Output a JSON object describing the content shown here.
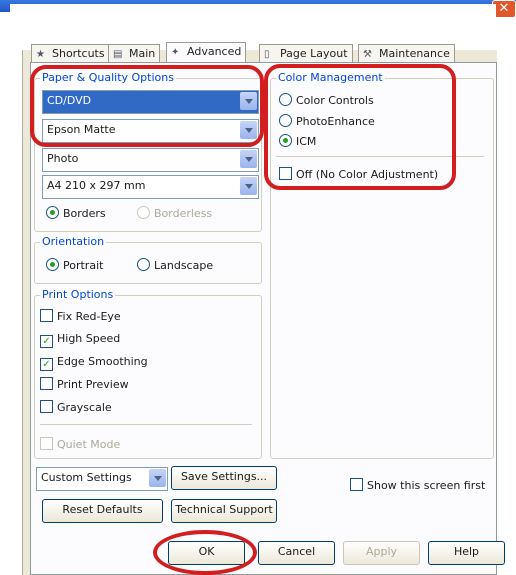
{
  "window": {
    "close_glyph": "✕"
  },
  "tabs": [
    {
      "label": "Shortcuts",
      "icon": "shortcuts-icon"
    },
    {
      "label": "Main",
      "icon": "main-icon"
    },
    {
      "label": "Advanced",
      "icon": "advanced-icon"
    },
    {
      "label": "Page Layout",
      "icon": "page-layout-icon"
    },
    {
      "label": "Maintenance",
      "icon": "maintenance-icon"
    }
  ],
  "paper_quality": {
    "title": "Paper & Quality Options",
    "source": "CD/DVD",
    "paper_type": "Epson Matte",
    "quality": "Photo",
    "size": "A4 210 x 297 mm",
    "borders": "Borders",
    "borderless": "Borderless"
  },
  "orientation": {
    "title": "Orientation",
    "portrait": "Portrait",
    "landscape": "Landscape"
  },
  "print_options": {
    "title": "Print Options",
    "fix_red_eye": "Fix Red-Eye",
    "high_speed": "High Speed",
    "edge_smoothing": "Edge Smoothing",
    "print_preview": "Print Preview",
    "grayscale": "Grayscale",
    "quiet_mode": "Quiet Mode"
  },
  "color_management": {
    "title": "Color Management",
    "color_controls": "Color Controls",
    "photo_enhance": "PhotoEnhance",
    "icm": "ICM",
    "off": "Off (No Color Adjustment)"
  },
  "settings": {
    "custom": "Custom Settings",
    "save": "Save Settings...",
    "reset": "Reset Defaults",
    "support": "Technical Support",
    "show_first": "Show this screen first"
  },
  "footer": {
    "ok": "OK",
    "cancel": "Cancel",
    "apply": "Apply",
    "help": "Help"
  },
  "colors": {
    "highlight": "#d21e1e",
    "group_label": "#0046d5",
    "selection": "#316ac5"
  }
}
